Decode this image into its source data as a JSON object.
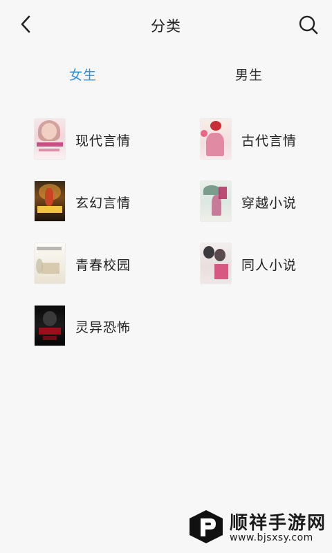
{
  "header": {
    "title": "分类",
    "back_icon": "chevron-left-icon",
    "search_icon": "search-icon"
  },
  "tabs": [
    {
      "label": "女生",
      "active": true,
      "color": "#2f8fd8"
    },
    {
      "label": "男生",
      "active": false,
      "color": "#333333"
    }
  ],
  "categories": [
    {
      "label": "现代言情",
      "cover": "modern-romance-cover"
    },
    {
      "label": "古代言情",
      "cover": "ancient-romance-cover"
    },
    {
      "label": "玄幻言情",
      "cover": "fantasy-romance-cover"
    },
    {
      "label": "穿越小说",
      "cover": "time-travel-cover"
    },
    {
      "label": "青春校园",
      "cover": "youth-campus-cover"
    },
    {
      "label": "同人小说",
      "cover": "fan-fiction-cover"
    },
    {
      "label": "灵异恐怖",
      "cover": "supernatural-horror-cover"
    }
  ],
  "watermark": {
    "name": "顺祥手游网",
    "url": "www.bjsxsy.com"
  },
  "colors": {
    "accent": "#2f8fd8",
    "background": "#f7f7f8"
  }
}
